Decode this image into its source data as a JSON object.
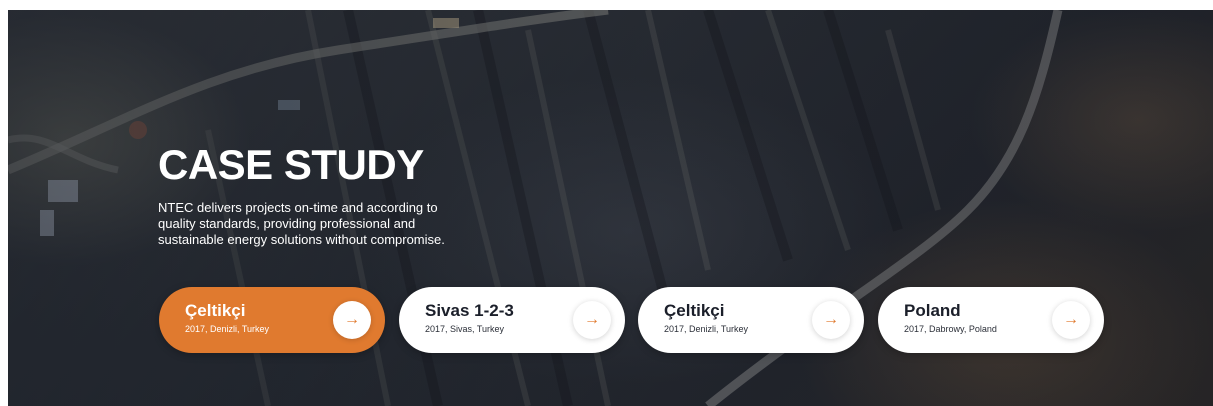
{
  "hero": {
    "title": "CASE STUDY",
    "description": "NTEC delivers projects on-time and according to quality standards, providing professional and sustainable energy solutions without compromise."
  },
  "cards": [
    {
      "name": "Çeltikçi",
      "meta": "2017, Denizli, Turkey",
      "active": true
    },
    {
      "name": "Sivas 1-2-3",
      "meta": "2017, Sivas, Turkey",
      "active": false
    },
    {
      "name": "Çeltikçi",
      "meta": "2017, Denizli, Turkey",
      "active": false
    },
    {
      "name": "Poland",
      "meta": "2017, Dabrowy, Poland",
      "active": false
    }
  ],
  "arrow_glyph": "→",
  "colors": {
    "accent": "#e07a2f",
    "card_bg": "#ffffff",
    "text_dark": "#1b1f2a"
  }
}
